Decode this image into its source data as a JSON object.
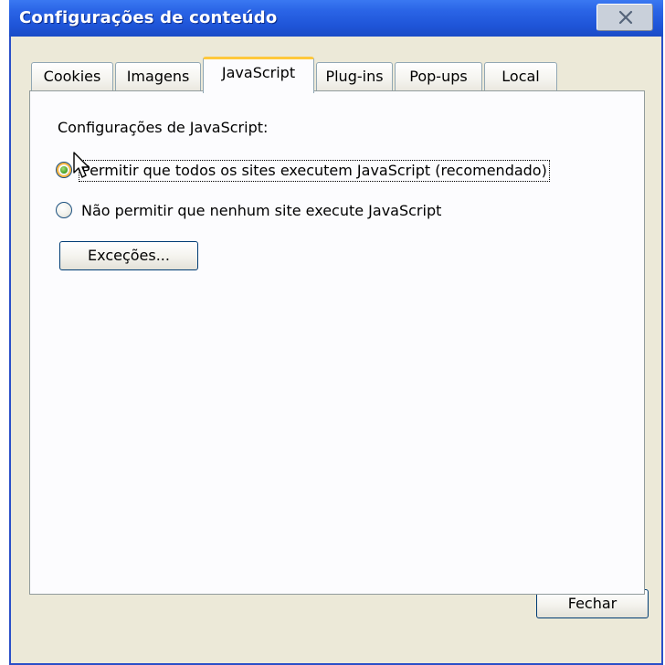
{
  "window": {
    "title": "Configurações de conteúdo"
  },
  "tabs": [
    {
      "label": "Cookies",
      "active": false
    },
    {
      "label": "Imagens",
      "active": false
    },
    {
      "label": "JavaScript",
      "active": true
    },
    {
      "label": "Plug-ins",
      "active": false
    },
    {
      "label": "Pop-ups",
      "active": false
    },
    {
      "label": "Local",
      "active": false
    }
  ],
  "javascript_panel": {
    "section_label": "Configurações de JavaScript:",
    "options": [
      {
        "label": "Permitir que todos os sites executem JavaScript (recomendado)",
        "selected": true
      },
      {
        "label": "Não permitir que nenhum site execute JavaScript",
        "selected": false
      }
    ],
    "exceptions_button": "Exceções..."
  },
  "footer": {
    "close_button": "Fechar"
  },
  "colors": {
    "titlebar": "#2a64e6",
    "active_tab_accent": "#ffc83c",
    "dialog_background": "#ece9d8",
    "panel_background": "#fcfcfe",
    "button_border": "#003c74"
  },
  "icons": {
    "close": "close-x-icon",
    "pointer": "mouse-pointer-icon"
  }
}
